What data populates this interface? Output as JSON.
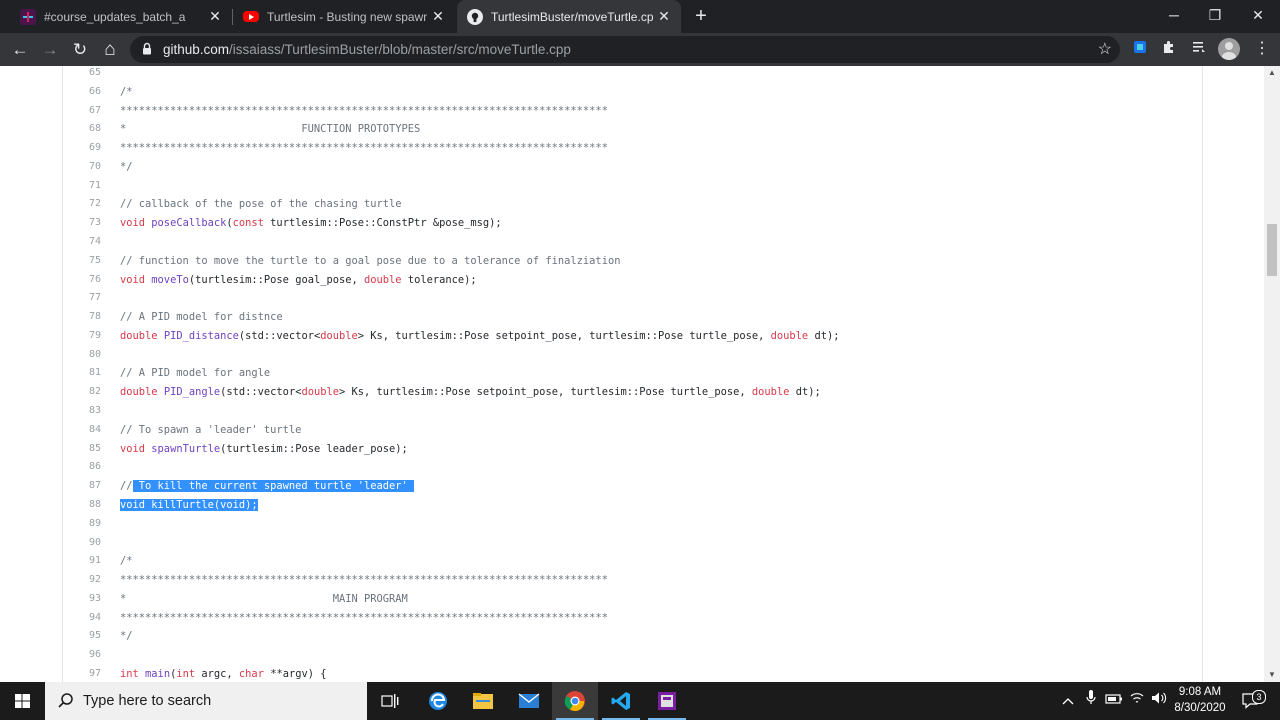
{
  "tabs": [
    {
      "title": "#course_updates_batch_a",
      "close": "✕",
      "favicon": "slack-icon"
    },
    {
      "title": "Turtlesim - Busting new spawned",
      "close": "✕",
      "favicon": "youtube-icon"
    },
    {
      "title": "TurtlesimBuster/moveTurtle.cpp",
      "close": "✕",
      "favicon": "github-icon",
      "active": true
    }
  ],
  "new_tab": "+",
  "window": {
    "minimize": "─",
    "maximize": "❐",
    "close": "✕"
  },
  "toolbar": {
    "back": "←",
    "forward": "→",
    "reload": "↻",
    "home": "⌂"
  },
  "address": {
    "domain": "github.com",
    "path": "/issaiass/TurtlesimBuster/blob/master/src/moveTurtle.cpp",
    "star": "☆"
  },
  "code_lines": [
    {
      "n": "65",
      "code": ""
    },
    {
      "n": "66",
      "code": "/*"
    },
    {
      "n": "67",
      "code": "******************************************************************************"
    },
    {
      "n": "68",
      "code": "*                            FUNCTION PROTOTYPES"
    },
    {
      "n": "69",
      "code": "******************************************************************************"
    },
    {
      "n": "70",
      "code": "*/"
    },
    {
      "n": "71",
      "code": ""
    },
    {
      "n": "72",
      "code": "// callback of the pose of the chasing turtle"
    },
    {
      "n": "73",
      "code": "void poseCallback(const turtlesim::Pose::ConstPtr &pose_msg);"
    },
    {
      "n": "74",
      "code": ""
    },
    {
      "n": "75",
      "code": "// function to move the turtle to a goal pose due to a tolerance of finalziation"
    },
    {
      "n": "76",
      "code": "void moveTo(turtlesim::Pose goal_pose, double tolerance);"
    },
    {
      "n": "77",
      "code": ""
    },
    {
      "n": "78",
      "code": "// A PID model for distnce"
    },
    {
      "n": "79",
      "code": "double PID_distance(std::vector<double> Ks, turtlesim::Pose setpoint_pose, turtlesim::Pose turtle_pose, double dt);"
    },
    {
      "n": "80",
      "code": ""
    },
    {
      "n": "81",
      "code": "// A PID model for angle"
    },
    {
      "n": "82",
      "code": "double PID_angle(std::vector<double> Ks, turtlesim::Pose setpoint_pose, turtlesim::Pose turtle_pose, double dt);"
    },
    {
      "n": "83",
      "code": ""
    },
    {
      "n": "84",
      "code": "// To spawn a 'leader' turtle"
    },
    {
      "n": "85",
      "code": "void spawnTurtle(turtlesim::Pose leader_pose);"
    },
    {
      "n": "86",
      "code": ""
    },
    {
      "n": "87",
      "code": "// To kill the current spawned turtle 'leader'"
    },
    {
      "n": "88",
      "code": "void killTurtle(void);"
    },
    {
      "n": "89",
      "code": ""
    },
    {
      "n": "90",
      "code": ""
    },
    {
      "n": "91",
      "code": "/*"
    },
    {
      "n": "92",
      "code": "******************************************************************************"
    },
    {
      "n": "93",
      "code": "*                                 MAIN PROGRAM"
    },
    {
      "n": "94",
      "code": "******************************************************************************"
    },
    {
      "n": "95",
      "code": "*/"
    },
    {
      "n": "96",
      "code": ""
    },
    {
      "n": "97",
      "code": "int main(int argc, char **argv) {"
    }
  ],
  "taskbar": {
    "search_placeholder": "Type here to search",
    "apps": [
      "task-view-icon",
      "edge-icon",
      "file-explorer-icon",
      "mail-icon",
      "chrome-icon",
      "vscode-icon",
      "app-icon"
    ],
    "time": "9:08 AM",
    "date": "8/30/2020",
    "notifications": "3"
  },
  "colors": {
    "keyword": "#d73a49",
    "function": "#6f42c1",
    "comment": "#6a737d",
    "selection": "#3390ff"
  }
}
